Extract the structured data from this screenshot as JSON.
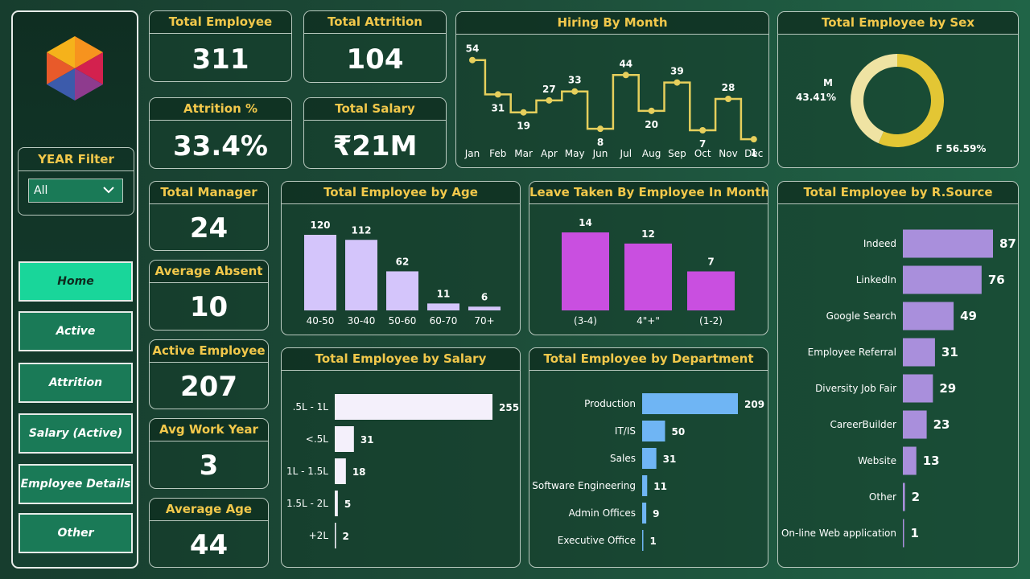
{
  "sidebar": {
    "year_filter": {
      "title": "YEAR Filter",
      "selected": "All"
    },
    "nav": [
      {
        "label": "Home",
        "active": true
      },
      {
        "label": "Active",
        "active": false
      },
      {
        "label": "Attrition",
        "active": false
      },
      {
        "label": "Salary (Active)",
        "active": false
      },
      {
        "label": "Employee Details",
        "active": false
      },
      {
        "label": "Other",
        "active": false
      }
    ]
  },
  "kpis": {
    "total_employee": {
      "title": "Total Employee",
      "value": "311"
    },
    "total_attrition": {
      "title": "Total Attrition",
      "value": "104"
    },
    "attrition_pct": {
      "title": "Attrition %",
      "value": "33.4%"
    },
    "total_salary": {
      "title": "Total Salary",
      "value": "₹21M"
    },
    "total_manager": {
      "title": "Total Manager",
      "value": "24"
    },
    "average_absent": {
      "title": "Average Absent",
      "value": "10"
    },
    "active_employee": {
      "title": "Active Employee",
      "value": "207"
    },
    "avg_work_year": {
      "title": "Avg Work Year",
      "value": "3"
    },
    "average_age": {
      "title": "Average Age",
      "value": "44"
    }
  },
  "colors": {
    "accent_title": "#f2c84b",
    "line": "#e6cf5c",
    "age_bar": "#d4c5fb",
    "leave_bar": "#c94fe0",
    "salary_bar": "#f4f0fb",
    "dept_bar": "#6fb5f4",
    "source_bar": "#a98fdc",
    "donut_f": "#e3c634",
    "donut_m": "#efe3a3"
  },
  "chart_data": [
    {
      "id": "hiring",
      "type": "line",
      "title": "Hiring By Month",
      "categories": [
        "Jan",
        "Feb",
        "Mar",
        "Apr",
        "May",
        "Jun",
        "Jul",
        "Aug",
        "Sep",
        "Oct",
        "Nov",
        "Dec"
      ],
      "values": [
        54,
        31,
        19,
        27,
        33,
        8,
        44,
        20,
        39,
        7,
        28,
        1
      ],
      "ylim": [
        0,
        56
      ]
    },
    {
      "id": "sex",
      "type": "pie",
      "title": "Total Employee by Sex",
      "categories": [
        "M",
        "F"
      ],
      "values": [
        43.41,
        56.59
      ],
      "labels": [
        "M\n43.41%",
        "F 56.59%"
      ]
    },
    {
      "id": "age",
      "type": "bar",
      "title": "Total Employee by Age",
      "categories": [
        "40-50",
        "30-40",
        "50-60",
        "60-70",
        "70+"
      ],
      "values": [
        120,
        112,
        62,
        11,
        6
      ]
    },
    {
      "id": "leave",
      "type": "bar",
      "title": "Leave Taken By Employee In Month",
      "categories": [
        "(3-4)",
        "4\"+\"",
        "(1-2)"
      ],
      "values": [
        14,
        12,
        7
      ]
    },
    {
      "id": "salary",
      "type": "bar",
      "orientation": "horizontal",
      "title": "Total Employee by Salary",
      "categories": [
        ".5L - 1L",
        "<.5L",
        "1L - 1.5L",
        "1.5L - 2L",
        "+2L"
      ],
      "values": [
        255,
        31,
        18,
        5,
        2
      ]
    },
    {
      "id": "department",
      "type": "bar",
      "orientation": "horizontal",
      "title": "Total Employee by Department",
      "categories": [
        "Production",
        "IT/IS",
        "Sales",
        "Software Engineering",
        "Admin Offices",
        "Executive Office"
      ],
      "values": [
        209,
        50,
        31,
        11,
        9,
        1
      ]
    },
    {
      "id": "source",
      "type": "bar",
      "orientation": "horizontal",
      "title": "Total Employee by R.Source",
      "categories": [
        "Indeed",
        "LinkedIn",
        "Google Search",
        "Employee Referral",
        "Diversity Job Fair",
        "CareerBuilder",
        "Website",
        "Other",
        "On-line Web application"
      ],
      "values": [
        87,
        76,
        49,
        31,
        29,
        23,
        13,
        2,
        1
      ]
    }
  ]
}
